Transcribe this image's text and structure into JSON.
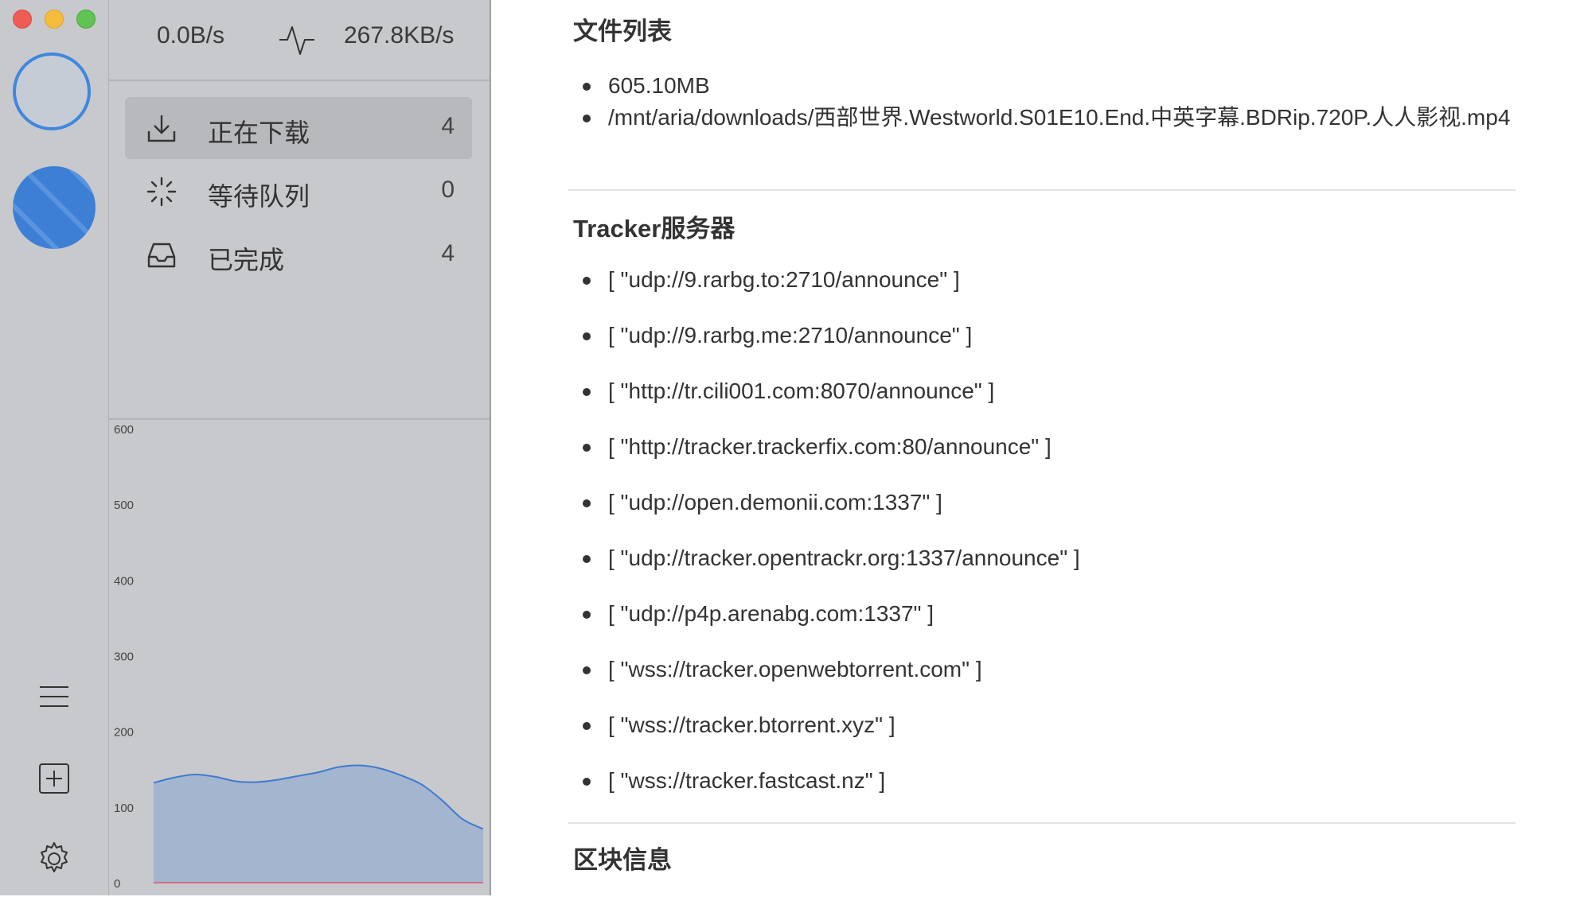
{
  "window": {
    "traffic_lights": [
      "close",
      "minimize",
      "zoom"
    ],
    "colors": {
      "red": "#ee5c54",
      "yellow": "#f6bd3d",
      "green": "#5fc453",
      "accent": "#3f86e0"
    }
  },
  "speed": {
    "upload": "0.0B/s",
    "download": "267.8KB/s",
    "icon": "activity-icon"
  },
  "menu": [
    {
      "label": "正在下载",
      "count": "4",
      "icon": "download-icon",
      "active": true
    },
    {
      "label": "等待队列",
      "count": "0",
      "icon": "loading-icon",
      "active": false
    },
    {
      "label": "已完成",
      "count": "4",
      "icon": "inbox-icon",
      "active": false
    }
  ],
  "rail_buttons": [
    "menu-icon",
    "add-task-icon",
    "settings-icon"
  ],
  "chart_data": {
    "type": "area",
    "y_ticks": [
      "600",
      "500",
      "400",
      "300",
      "200",
      "100",
      "0"
    ],
    "ylim": [
      0,
      600
    ],
    "series": [
      {
        "values": [
          133,
          140,
          144,
          141,
          135,
          134,
          137,
          142,
          147,
          154,
          156,
          152,
          143,
          131,
          110,
          85,
          72
        ]
      },
      {
        "values": [
          1,
          1,
          1,
          1,
          1,
          1,
          1,
          1,
          1,
          1,
          1,
          1,
          1,
          1,
          1,
          1,
          1
        ]
      }
    ],
    "fill_color": "#a3b5cf",
    "line_color": "#3f7ad0",
    "baseline_color": "#e05a6a"
  },
  "files": {
    "heading": "文件列表",
    "items": [
      "605.10MB",
      "/mnt/aria/downloads/西部世界.Westworld.S01E10.End.中英字幕.BDRip.720P.人人影视.mp4"
    ]
  },
  "trackers": {
    "heading": "Tracker服务器",
    "items": [
      "[ \"udp://9.rarbg.to:2710/announce\" ]",
      "[ \"udp://9.rarbg.me:2710/announce\" ]",
      "[ \"http://tr.cili001.com:8070/announce\" ]",
      "[ \"http://tracker.trackerfix.com:80/announce\" ]",
      "[ \"udp://open.demonii.com:1337\" ]",
      "[ \"udp://tracker.opentrackr.org:1337/announce\" ]",
      "[ \"udp://p4p.arenabg.com:1337\" ]",
      "[ \"wss://tracker.openwebtorrent.com\" ]",
      "[ \"wss://tracker.btorrent.xyz\" ]",
      "[ \"wss://tracker.fastcast.nz\" ]"
    ]
  },
  "blocks": {
    "heading": "区块信息"
  }
}
